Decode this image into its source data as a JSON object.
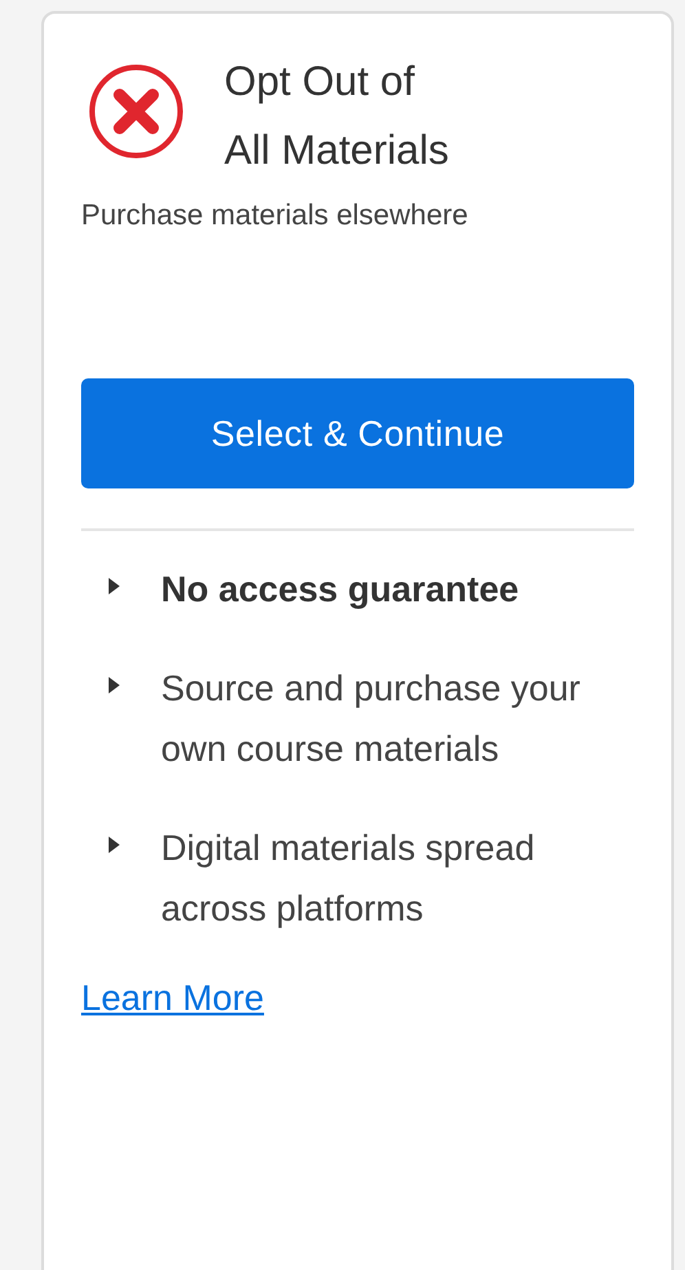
{
  "option": {
    "title_lines": [
      "Opt Out of",
      "All Materials"
    ],
    "subtitle": "Purchase materials elsewhere",
    "button": "Select & Continue",
    "features": [
      {
        "text": "No access guarantee",
        "bold": true
      },
      {
        "text": "Source and purchase your own course materials",
        "bold": false
      },
      {
        "text": "Digital materials spread across platforms",
        "bold": false
      }
    ],
    "link": "Learn More"
  }
}
